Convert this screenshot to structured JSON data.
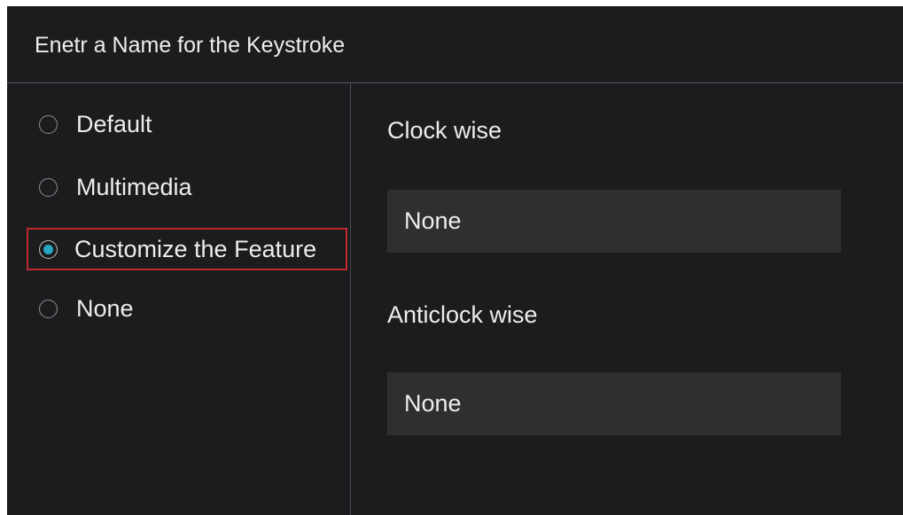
{
  "dialog": {
    "title": "Enetr a Name for the Keystroke"
  },
  "options": {
    "items": [
      {
        "label": "Default",
        "selected": false
      },
      {
        "label": "Multimedia",
        "selected": false
      },
      {
        "label": "Customize the Feature",
        "selected": true
      },
      {
        "label": "None",
        "selected": false
      }
    ]
  },
  "fields": {
    "clockwise": {
      "label": "Clock wise",
      "value": "None"
    },
    "anticlockwise": {
      "label": "Anticlock wise",
      "value": "None"
    }
  },
  "colors": {
    "background": "#1b1c1e",
    "input_background": "#2e2f31",
    "accent": "#2aa6c1",
    "highlight_border": "#c0292f",
    "text": "#ededed"
  }
}
